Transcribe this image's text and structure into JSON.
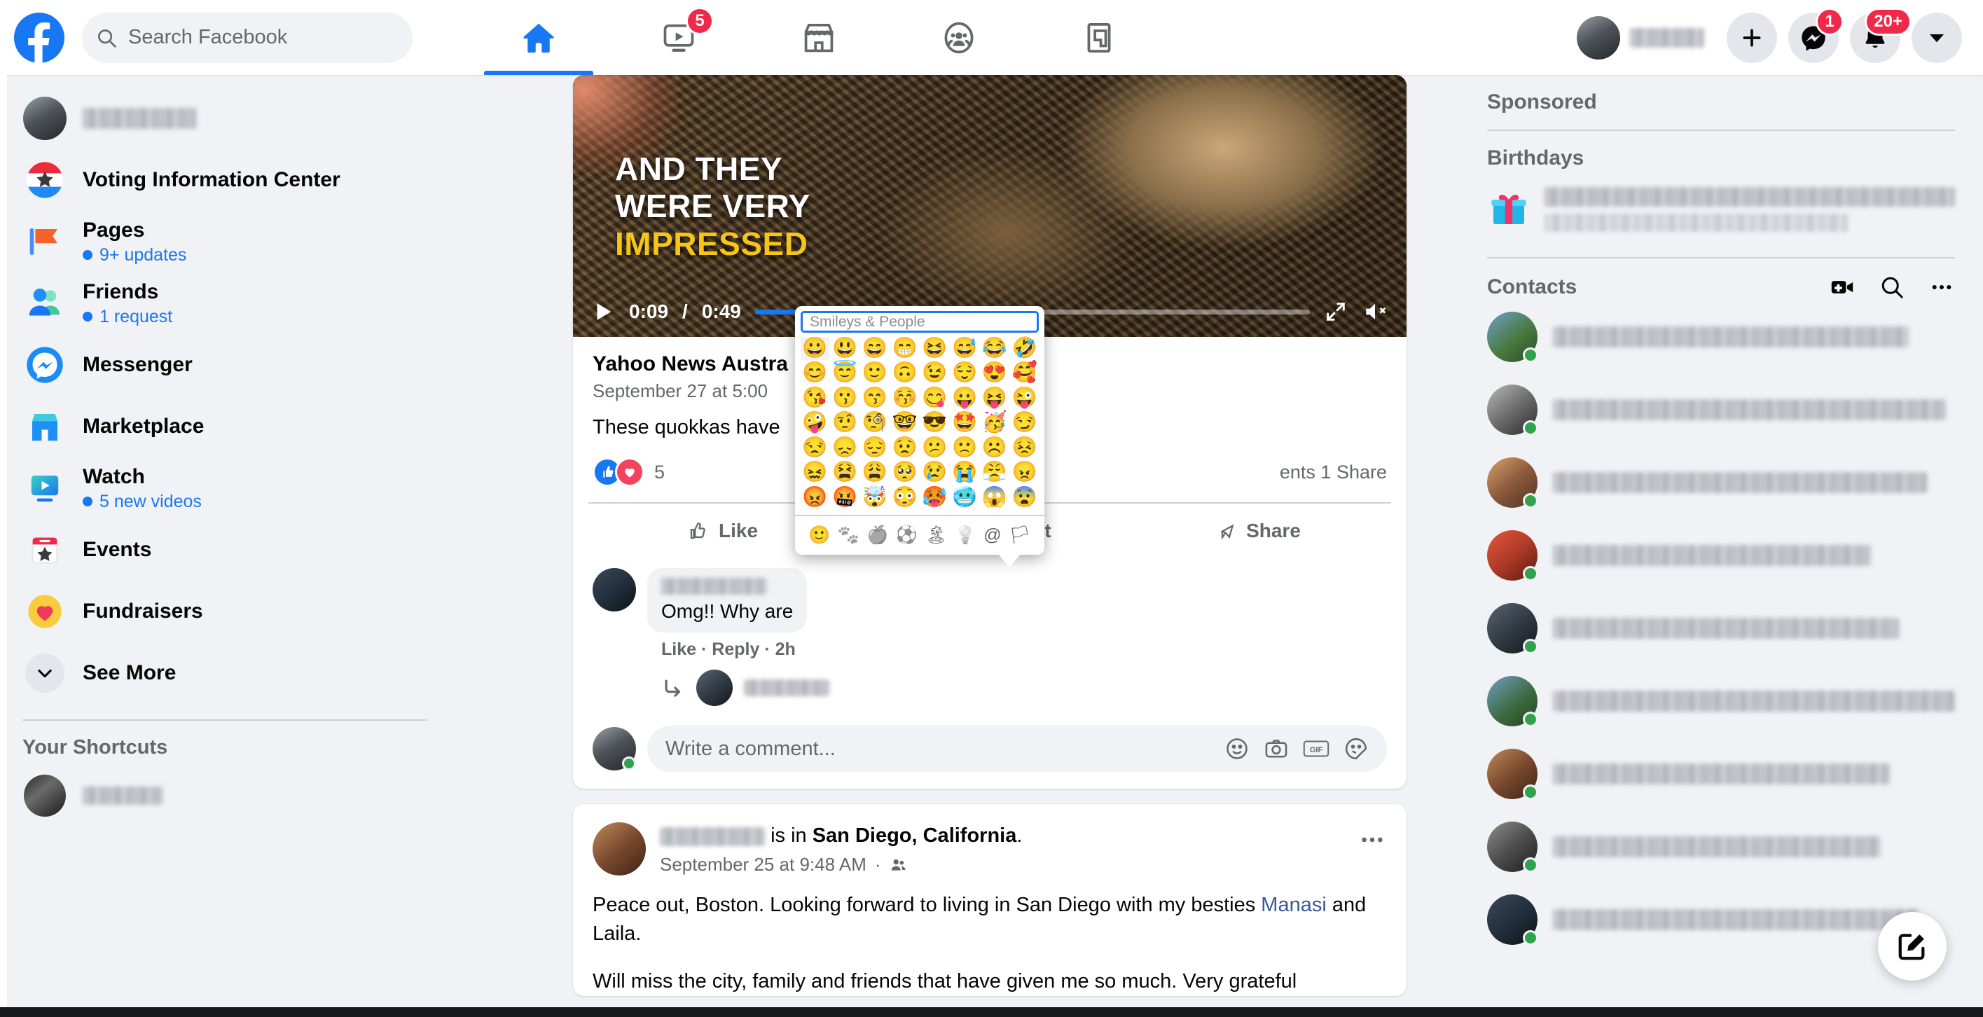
{
  "nav": {
    "logo": "facebook-logo",
    "search_placeholder": "Search Facebook",
    "tabs": [
      {
        "name": "home",
        "icon": "home-icon",
        "active": true,
        "badge": ""
      },
      {
        "name": "watch",
        "icon": "watch-video-icon",
        "active": false,
        "badge": "5"
      },
      {
        "name": "marketplace",
        "icon": "marketplace-store-icon",
        "active": false,
        "badge": ""
      },
      {
        "name": "groups",
        "icon": "groups-people-icon",
        "active": false,
        "badge": ""
      },
      {
        "name": "gaming",
        "icon": "gaming-icon",
        "active": false,
        "badge": ""
      }
    ],
    "profile_name_blurred": true,
    "create_label": "+",
    "messenger_badge": "1",
    "notifications_badge": "20+"
  },
  "sidebar": {
    "profile_name_blurred": true,
    "items": [
      {
        "label": "Voting Information Center",
        "sub": "",
        "icon": "voting-badge-icon"
      },
      {
        "label": "Pages",
        "sub": "9+ updates",
        "icon": "pages-flag-icon"
      },
      {
        "label": "Friends",
        "sub": "1 request",
        "icon": "friends-icon"
      },
      {
        "label": "Messenger",
        "sub": "",
        "icon": "messenger-icon"
      },
      {
        "label": "Marketplace",
        "sub": "",
        "icon": "marketplace-icon"
      },
      {
        "label": "Watch",
        "sub": "5 new videos",
        "icon": "watch-icon"
      },
      {
        "label": "Events",
        "sub": "",
        "icon": "events-calendar-icon"
      },
      {
        "label": "Fundraisers",
        "sub": "",
        "icon": "fundraisers-heart-icon"
      },
      {
        "label": "See More",
        "sub": "",
        "icon": "chevron-down-icon"
      }
    ],
    "shortcuts_header": "Your Shortcuts",
    "shortcut_name_blurred": true
  },
  "feed": {
    "post1": {
      "video": {
        "caption_line1": "AND THEY",
        "caption_line2": "WERE VERY",
        "caption_line3": "IMPRESSED",
        "current_time": "0:09",
        "total_time": "0:49",
        "progress_percent": 19,
        "play_icon": "play-icon",
        "fullscreen_icon": "fullscreen-icon",
        "mute_icon": "volume-muted-icon"
      },
      "author": "Yahoo News Austra",
      "timestamp": "September 27 at 5:00",
      "body": "These quokkas have",
      "reaction_count": "5",
      "comment_share_text": "ents 1 Share",
      "actions": [
        "Like",
        "Comment",
        "Share"
      ],
      "comment": {
        "author_blurred": true,
        "text": "Omg!! Why are",
        "like_label": "Like",
        "reply_label": "Reply",
        "time": "2h"
      },
      "write_placeholder": "Write a comment...",
      "write_icons": [
        "emoji-icon",
        "camera-icon",
        "gif-icon",
        "sticker-icon"
      ]
    },
    "post2": {
      "author_blurred": true,
      "checkin_prefix": "is in",
      "location": "San Diego, California",
      "period": ".",
      "timestamp": "September 25 at 9:48 AM",
      "audience_icon": "friends-audience-icon",
      "more_icon": "more-options-icon",
      "body_part1": "Peace out, Boston. Looking forward to living in San Diego with my besties ",
      "body_link": "Manasi",
      "body_part2": " and Laila.",
      "body_line2": "Will miss the city, family and friends that have given me so much. Very grateful"
    }
  },
  "emoji_picker": {
    "search_placeholder": "Smileys & People",
    "rows": [
      [
        "😀",
        "😃",
        "😄",
        "😁",
        "😆",
        "😅",
        "😂",
        "🤣"
      ],
      [
        "😊",
        "😇",
        "🙂",
        "🙃",
        "😉",
        "😌",
        "😍",
        "🥰"
      ],
      [
        "😘",
        "😗",
        "😙",
        "😚",
        "😋",
        "😛",
        "😝",
        "😜"
      ],
      [
        "🤪",
        "🤨",
        "🧐",
        "🤓",
        "😎",
        "🤩",
        "🥳",
        "😏"
      ],
      [
        "😒",
        "😞",
        "😔",
        "😟",
        "😕",
        "🙁",
        "☹️",
        "😣"
      ],
      [
        "😖",
        "😫",
        "😩",
        "🥺",
        "😢",
        "😭",
        "😤",
        "😠"
      ],
      [
        "😡",
        "🤬",
        "🤯",
        "😳",
        "🥵",
        "🥶",
        "😱",
        "😨"
      ]
    ],
    "tabs": [
      {
        "icon": "smiley-category-icon",
        "selected": true
      },
      {
        "icon": "animals-paw-category-icon",
        "selected": false
      },
      {
        "icon": "food-apple-category-icon",
        "selected": false
      },
      {
        "icon": "sports-ball-category-icon",
        "selected": false
      },
      {
        "icon": "travel-category-icon",
        "selected": false
      },
      {
        "icon": "objects-bulb-category-icon",
        "selected": false
      },
      {
        "icon": "symbols-at-category-icon",
        "selected": false
      },
      {
        "icon": "flags-category-icon",
        "selected": false
      }
    ]
  },
  "rightbar": {
    "sponsored_header": "Sponsored",
    "birthdays_header": "Birthdays",
    "birthday_icon": "gift-icon",
    "birthday_text_blurred": true,
    "contacts_header": "Contacts",
    "contacts_icons": [
      "new-video-room-icon",
      "search-icon",
      "more-options-icon"
    ],
    "contacts": [
      {
        "online": true,
        "name_blurred": true
      },
      {
        "online": true,
        "name_blurred": true
      },
      {
        "online": true,
        "name_blurred": true
      },
      {
        "online": true,
        "name_blurred": true
      },
      {
        "online": true,
        "name_blurred": true
      },
      {
        "online": true,
        "name_blurred": true
      },
      {
        "online": true,
        "name_blurred": true
      },
      {
        "online": true,
        "name_blurred": true
      },
      {
        "online": true,
        "name_blurred": true
      }
    ],
    "compose_fab_icon": "compose-message-icon"
  },
  "colors": {
    "brand_blue": "#1877f2",
    "badge_red": "#f02849",
    "online_green": "#31a24c",
    "page_bg": "#f0f2f5",
    "text_primary": "#050505",
    "text_secondary": "#65676b"
  }
}
